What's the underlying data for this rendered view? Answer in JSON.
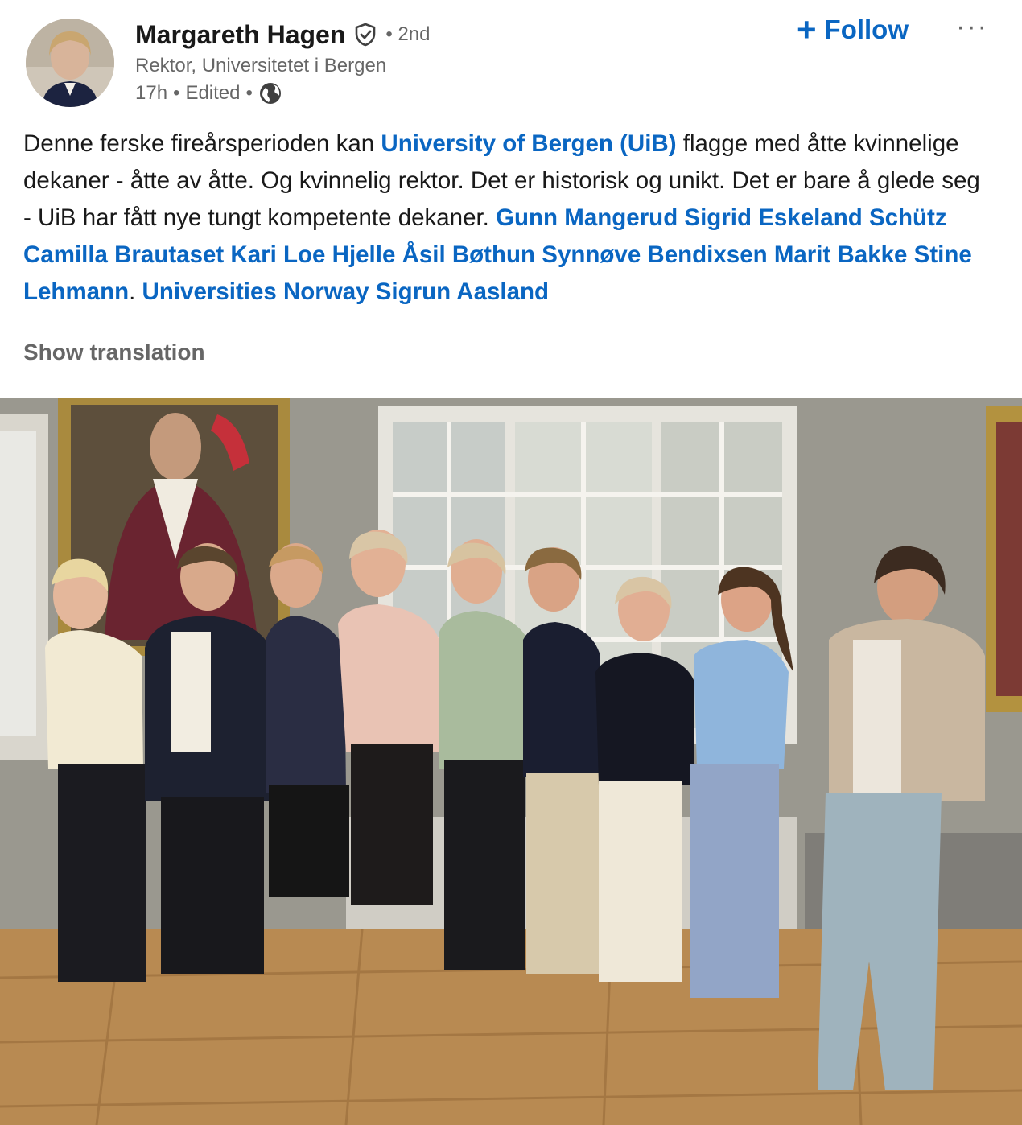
{
  "author": {
    "name": "Margareth Hagen",
    "degree": "• 2nd",
    "headline": "Rektor, Universitetet i Bergen",
    "time": "17h",
    "edited": "Edited"
  },
  "actions": {
    "follow_plus": "+",
    "follow_label": "Follow",
    "more_label": "···"
  },
  "commentary": {
    "t1": "Denne ferske fireårsperioden kan ",
    "m1": "University of Bergen (UiB)",
    "t2": " flagge med åtte kvinnelige dekaner - åtte av åtte. Og kvinnelig rektor. Det er historisk og unikt. Det er bare å glede seg - UiB har fått nye tungt kompetente dekaner. ",
    "m2": "Gunn Mangerud",
    "t3": " ",
    "m3": "Sigrid Eskeland Schütz",
    "t4": " ",
    "m4": "Camilla Brautaset",
    "t5": " ",
    "m5": "Kari Loe Hjelle",
    "t6": " ",
    "m6": "Åsil Bøthun",
    "t7": " ",
    "m7": "Synnøve Bendixsen",
    "t8": " ",
    "m8": "Marit Bakke",
    "t9": " ",
    "m9": "Stine Lehmann",
    "t10": ". ",
    "m10": "Universities Norway",
    "t11": " ",
    "m11": "Sigrun Aasland"
  },
  "show_translation": "Show translation",
  "colors": {
    "link": "#0a66c2",
    "text": "#191919",
    "secondary": "#666666"
  },
  "icons": {
    "verified": "verified-shield-icon",
    "globe": "globe-icon",
    "more": "ellipsis-icon"
  }
}
